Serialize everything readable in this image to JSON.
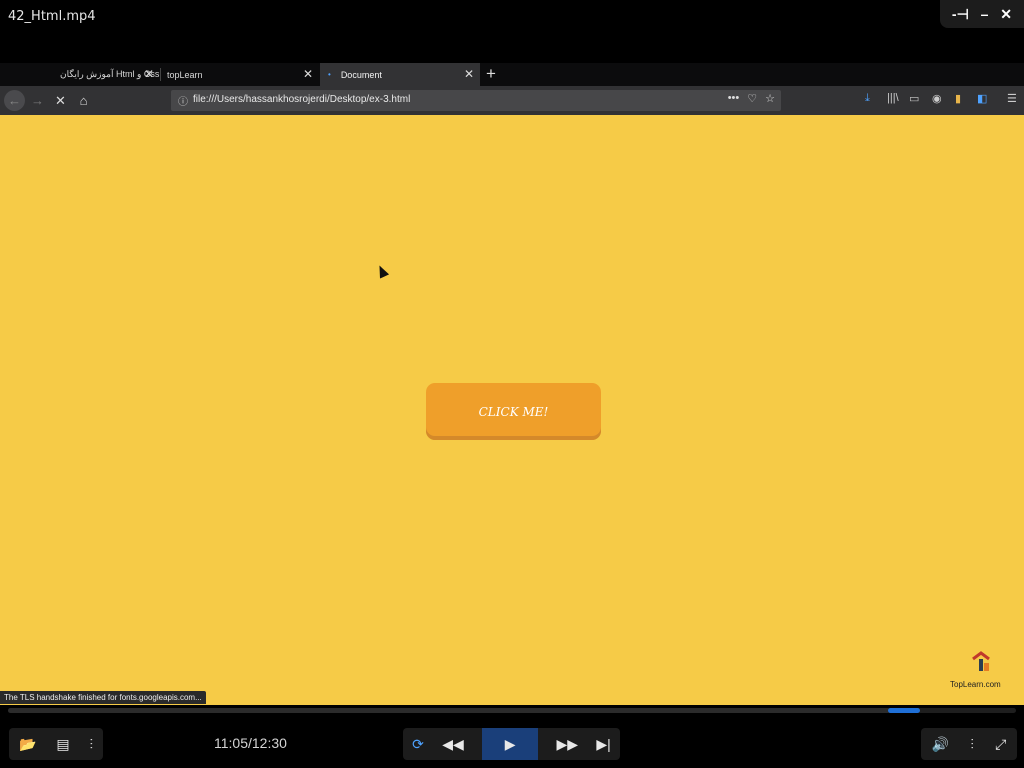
{
  "player": {
    "title": "42_Html.mp4",
    "time": "11:05/12:30",
    "progress_percent": 87.5
  },
  "window_controls": {
    "pin": "-⊣",
    "minimize": "–",
    "close": "✕"
  },
  "browser": {
    "tabs": [
      {
        "label": "آموزش رایگان Html و Css",
        "active": false
      },
      {
        "label": "topLearn",
        "active": false
      },
      {
        "label": "Document",
        "active": true
      }
    ],
    "new_tab_label": "+",
    "url": "file:///Users/hassankhosrojerdi/Desktop/ex-3.html",
    "status_text": "The TLS handshake finished for fonts.googleapis.com..."
  },
  "page": {
    "button_label": "CLICK ME!",
    "logo_text": "TopLearn.com"
  },
  "colors": {
    "page_bg": "#f6cb47",
    "button_bg": "#ef9f2a",
    "accent": "#1f6fd6"
  }
}
